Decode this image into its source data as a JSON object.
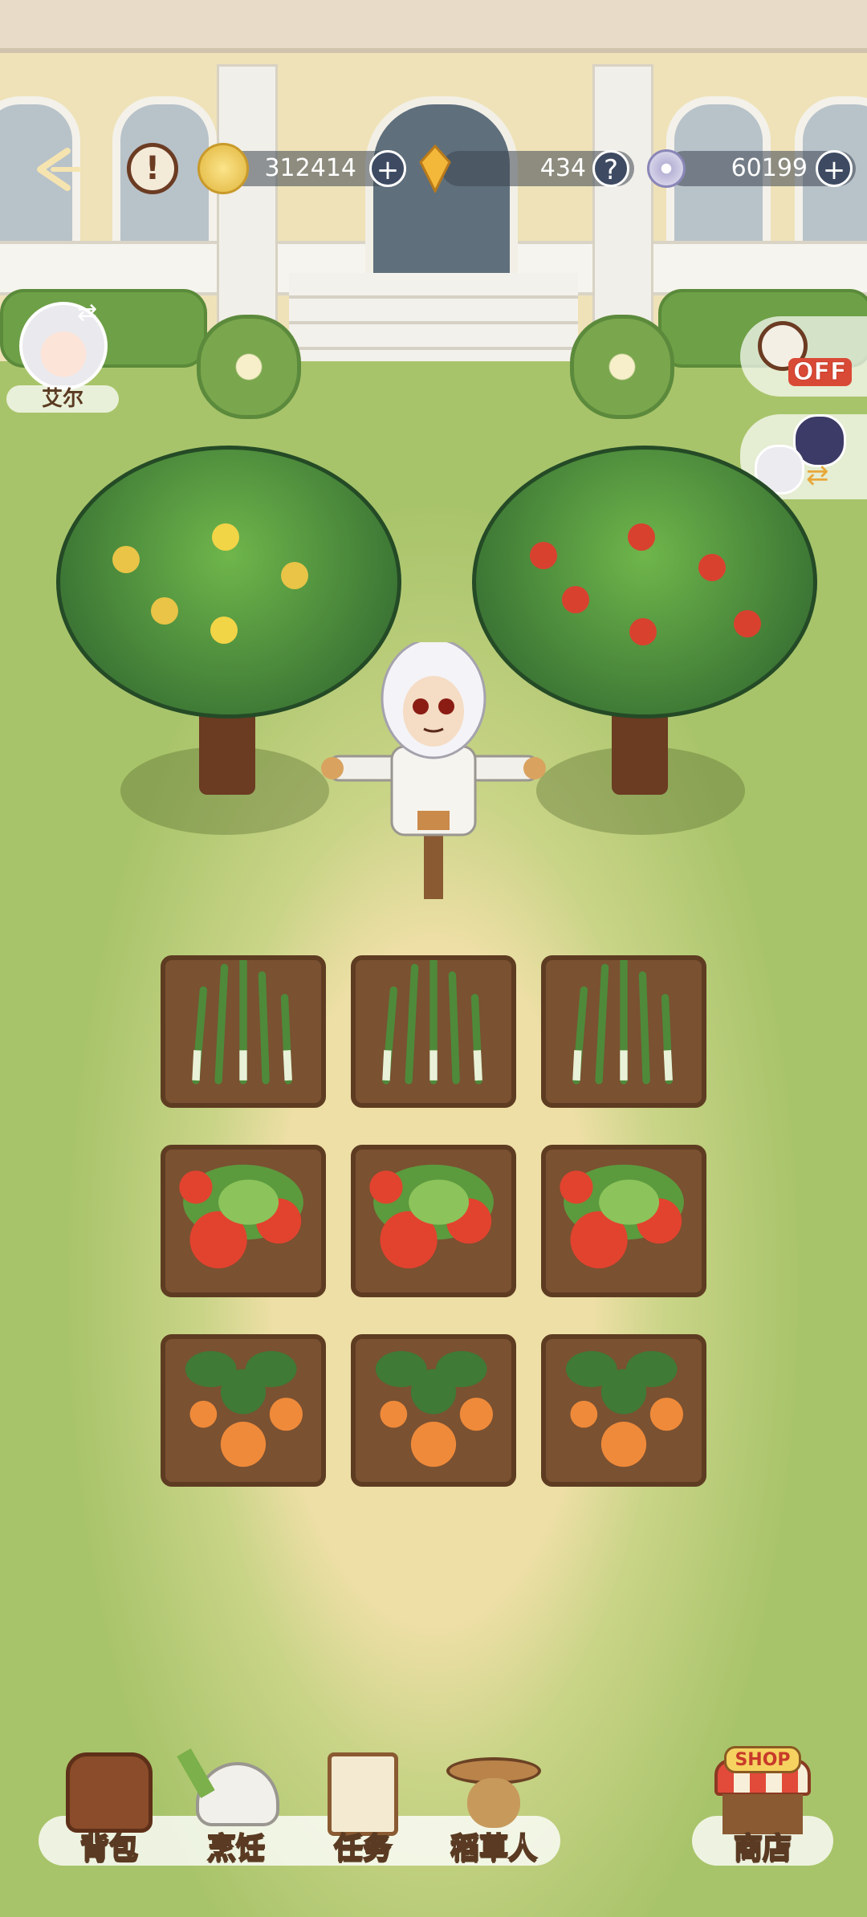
{
  "resources": {
    "gold": "312414",
    "crystal": "434",
    "orb": "60199"
  },
  "character": {
    "name": "艾尔"
  },
  "timer": {
    "status": "OFF"
  },
  "nav": {
    "bag": "背包",
    "cook": "烹饪",
    "task": "任务",
    "scarecrow": "稻草人",
    "shop": "商店",
    "shop_sign": "SHOP"
  },
  "plots": [
    {
      "crop": "asparagus"
    },
    {
      "crop": "asparagus"
    },
    {
      "crop": "asparagus"
    },
    {
      "crop": "tomato"
    },
    {
      "crop": "tomato"
    },
    {
      "crop": "tomato"
    },
    {
      "crop": "carrot"
    },
    {
      "crop": "carrot"
    },
    {
      "crop": "carrot"
    }
  ],
  "colors": {
    "accent": "#c83a2a",
    "soil": "#7a5131",
    "lawn": "#a8c46a"
  }
}
